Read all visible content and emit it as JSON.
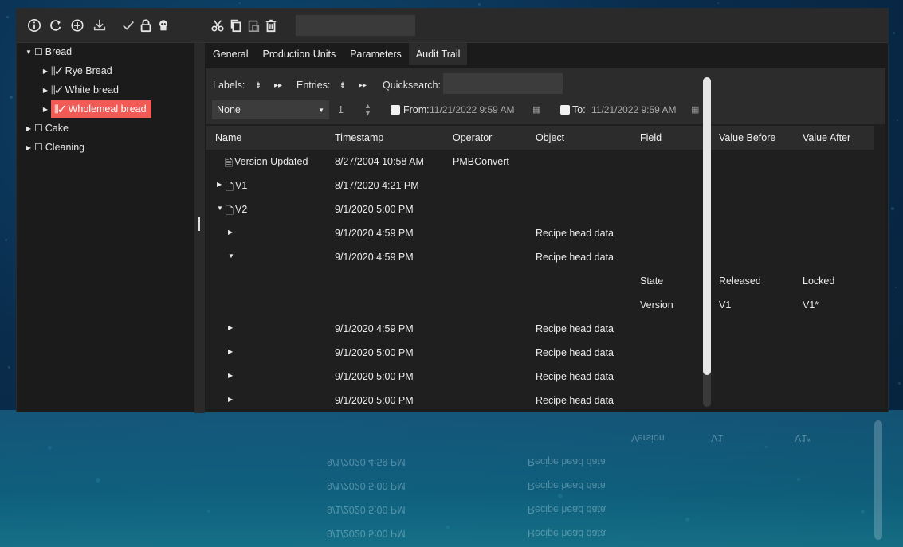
{
  "toolbar": {
    "icons": [
      "info-icon",
      "refresh-icon",
      "add-circle-icon",
      "download-icon",
      "check-icon",
      "lock-icon",
      "user-icon",
      "cut-icon",
      "copy-icon",
      "paste-icon",
      "delete-icon"
    ],
    "search_value": ""
  },
  "tree": {
    "items": [
      {
        "label": "Bread",
        "level": 0,
        "expanded": true
      },
      {
        "label": "Rye Bread",
        "level": 1
      },
      {
        "label": "White bread",
        "level": 1
      },
      {
        "label": "Wholemeal bread",
        "level": 1,
        "selected": true
      },
      {
        "label": "Cake",
        "level": 0
      },
      {
        "label": "Cleaning",
        "level": 0
      }
    ],
    "folder_glyph": "☐",
    "recipe_glyph": "⫼✓"
  },
  "tabs": [
    "General",
    "Production Units",
    "Parameters",
    "Audit Trail"
  ],
  "active_tab": "Audit Trail",
  "filters": {
    "labels_label": "Labels:",
    "entries_label": "Entries:",
    "quicksearch_label": "Quicksearch:",
    "quicksearch_value": "",
    "select_value": "None",
    "stepper_value": "1",
    "from_label": "From:",
    "from_value": "11/21/2022 9:59 AM",
    "to_label": "To:",
    "to_value": "11/21/2022 9:59 AM"
  },
  "grid": {
    "columns": [
      "Name",
      "Timestamp",
      "Operator",
      "Object",
      "Field",
      "Value Before",
      "Value After"
    ],
    "rows": [
      {
        "name": "Version Updated",
        "timestamp": "8/27/2004 10:58 AM",
        "operator": "PMBConvert",
        "object": "",
        "field": "",
        "before": "",
        "after": ""
      },
      {
        "name": "V1",
        "timestamp": "8/17/2020 4:21 PM",
        "operator": "",
        "object": "",
        "field": "",
        "before": "",
        "after": ""
      },
      {
        "name": "V2",
        "timestamp": "9/1/2020 5:00 PM",
        "operator": "",
        "object": "",
        "field": "",
        "before": "",
        "after": ""
      },
      {
        "name": "",
        "timestamp": "9/1/2020 4:59 PM",
        "operator": "",
        "object": "Recipe head data",
        "field": "",
        "before": "",
        "after": ""
      },
      {
        "name": "",
        "timestamp": "9/1/2020 4:59 PM",
        "operator": "",
        "object": "Recipe head data",
        "field": "",
        "before": "",
        "after": ""
      },
      {
        "name": "",
        "timestamp": "",
        "operator": "",
        "object": "",
        "field": "State",
        "before": "Released",
        "after": "Locked"
      },
      {
        "name": "",
        "timestamp": "",
        "operator": "",
        "object": "",
        "field": "Version",
        "before": "V1",
        "after": "V1*"
      },
      {
        "name": "",
        "timestamp": "9/1/2020 4:59 PM",
        "operator": "",
        "object": "Recipe head data",
        "field": "",
        "before": "",
        "after": ""
      },
      {
        "name": "",
        "timestamp": "9/1/2020 5:00 PM",
        "operator": "",
        "object": "Recipe head data",
        "field": "",
        "before": "",
        "after": ""
      },
      {
        "name": "",
        "timestamp": "9/1/2020 5:00 PM",
        "operator": "",
        "object": "Recipe head data",
        "field": "",
        "before": "",
        "after": ""
      },
      {
        "name": "",
        "timestamp": "9/1/2020 5:00 PM",
        "operator": "",
        "object": "Recipe head data",
        "field": "",
        "before": "",
        "after": ""
      }
    ]
  },
  "colors": {
    "selection": "#f15a55",
    "window_bg": "#1b1b1b",
    "toolbar_bg": "#2a2a2a",
    "desktop_bg": "#0a2d4d"
  }
}
